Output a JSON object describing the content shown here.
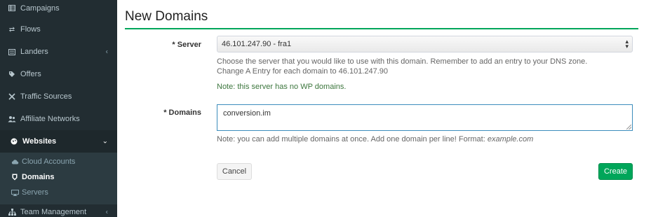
{
  "sidebar": {
    "items": [
      {
        "label": "Campaigns",
        "icon": "table-icon"
      },
      {
        "label": "Flows",
        "icon": "exchange-icon"
      },
      {
        "label": "Landers",
        "icon": "list-icon",
        "has_chevron": true
      },
      {
        "label": "Offers",
        "icon": "tag-icon"
      },
      {
        "label": "Traffic Sources",
        "icon": "arrows-icon"
      },
      {
        "label": "Affiliate Networks",
        "icon": "users-icon"
      },
      {
        "label": "Websites",
        "icon": "globe-icon",
        "expanded": true
      },
      {
        "label": "Team Management",
        "icon": "sitemap-icon",
        "has_chevron": true
      }
    ],
    "subitems": [
      {
        "label": "Cloud Accounts",
        "icon": "cloud-icon"
      },
      {
        "label": "Domains",
        "icon": "shield-icon",
        "current": true
      },
      {
        "label": "Servers",
        "icon": "desktop-icon"
      }
    ],
    "chevron_left": "‹",
    "chevron_down": "⌄"
  },
  "page": {
    "title": "New Domains"
  },
  "form": {
    "server_label": "* Server",
    "server_value": "46.101.247.90 - fra1",
    "server_help_1": "Choose the server that you would like to use with this domain. Remember to add an entry to your DNS zone.",
    "server_help_2": "Change A Entry for each domain to 46.101.247.90",
    "server_note": "Note: this server has no WP domains.",
    "domains_label": "* Domains",
    "domains_value": "conversion.im",
    "domains_help": "Note: you can add multiple domains at once. Add one domain per line! Format: ",
    "domains_help_example": "example.com",
    "cancel_label": "Cancel",
    "create_label": "Create"
  },
  "colors": {
    "sidebar_bg": "#222d32",
    "accent_green": "#00a65a",
    "focus_blue": "#3c8dbc"
  }
}
